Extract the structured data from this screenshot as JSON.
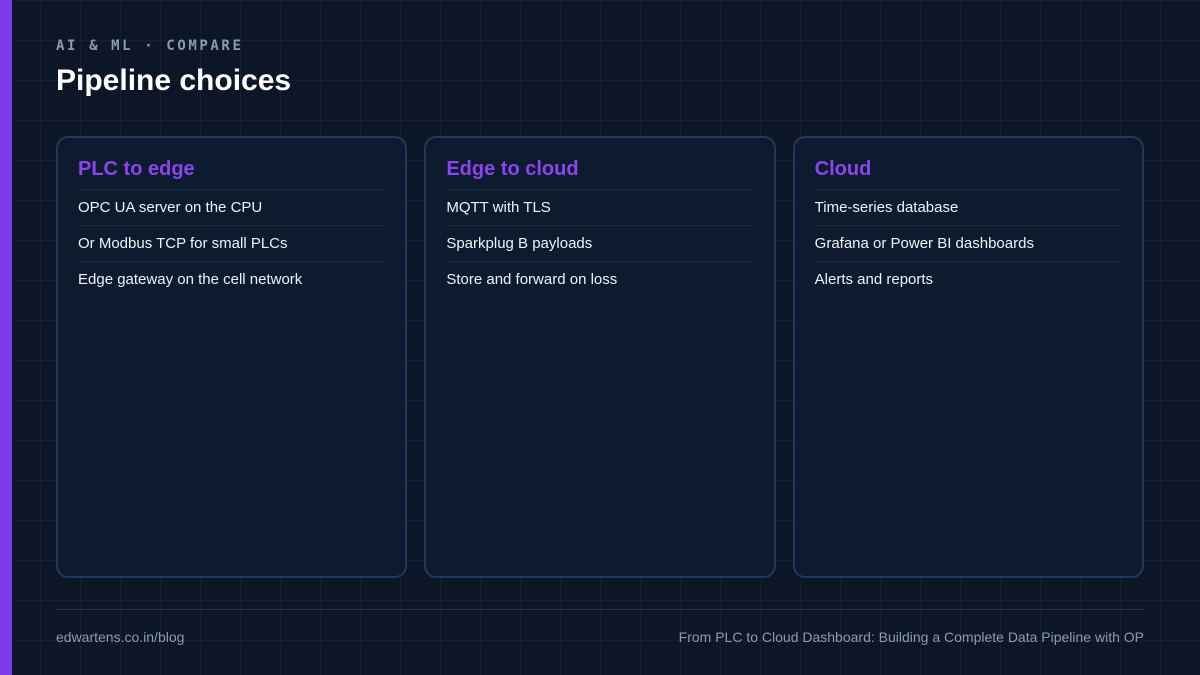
{
  "header": {
    "eyebrow": "AI & ML · COMPARE",
    "title": "Pipeline choices"
  },
  "cards": [
    {
      "title": "PLC to edge",
      "items": [
        "OPC UA server on the CPU",
        "Or Modbus TCP for small PLCs",
        "Edge gateway on the cell network"
      ]
    },
    {
      "title": "Edge to cloud",
      "items": [
        "MQTT with TLS",
        "Sparkplug B payloads",
        "Store and forward on loss"
      ]
    },
    {
      "title": "Cloud",
      "items": [
        "Time-series database",
        "Grafana or Power BI dashboards",
        "Alerts and reports"
      ]
    }
  ],
  "footer": {
    "site": "edwartens.co.in/blog",
    "article_title": "From PLC to Cloud Dashboard: Building a Complete Data Pipeline with OP"
  },
  "colors": {
    "background": "#0d1626",
    "accent": "#7c3aed",
    "card_title": "#8b45ee",
    "card_border": "#1f3a5c",
    "muted_text": "#8a9bb4"
  }
}
